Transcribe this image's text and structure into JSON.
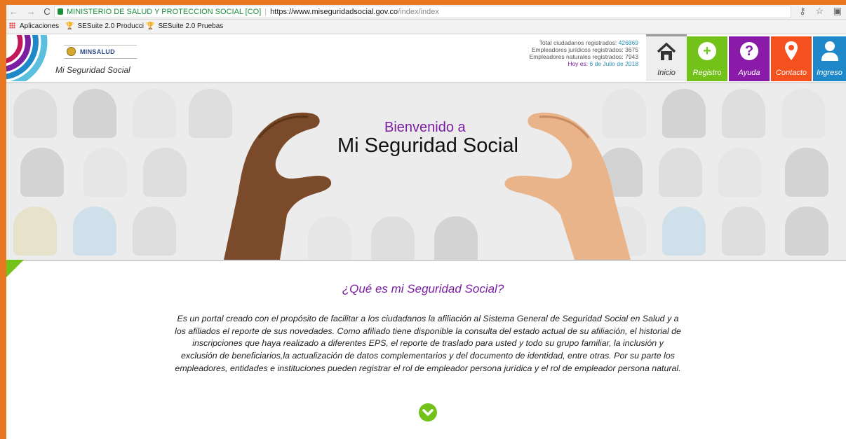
{
  "browser": {
    "site_name": "MINISTERIO DE SALUD Y PROTECCION SOCIAL [CO]",
    "url_host": "https://www.miseguridadsocial.gov.co",
    "url_path": "/index/index",
    "nav": {
      "back": "←",
      "forward": "→",
      "reload": "C"
    },
    "right_icons": {
      "key": "⚷",
      "star": "☆",
      "ext": "▣"
    }
  },
  "bookmarks": [
    {
      "label": "Aplicaciones"
    },
    {
      "label": "SESuite 2.0 Producci"
    },
    {
      "label": "SESuite 2.0 Pruebas"
    }
  ],
  "header": {
    "ministry": "MINSALUD",
    "app_name": "Mi Seguridad Social",
    "stats": {
      "citizens_label": "Total ciudadanos registrados:",
      "citizens_value": "426869",
      "juridicos": "Empleadores jurídicos registrados: 3675",
      "naturales": "Empleadores naturales registrados: 7943",
      "today_label": "Hoy es:",
      "today_value": "6 de Julio de 2018"
    },
    "nav": [
      {
        "label": "Inicio",
        "icon": "home-icon"
      },
      {
        "label": "Registro",
        "icon": "plus-icon",
        "glyph": "+"
      },
      {
        "label": "Ayuda",
        "icon": "question-icon",
        "glyph": "?"
      },
      {
        "label": "Contacto",
        "icon": "location-pin-icon"
      },
      {
        "label": "Ingreso",
        "icon": "user-icon"
      }
    ]
  },
  "hero": {
    "line1": "Bienvenido a",
    "line2": "Mi Seguridad Social"
  },
  "content": {
    "title": "¿Qué es mi Seguridad Social?",
    "description": "Es un portal creado con el propósito de facilitar a los ciudadanos la afiliación al Sistema General de Seguridad Social en Salud y a los afiliados el reporte de sus novedades. Como afiliado tiene disponible la consulta del estado actual de su afiliación, el historial de inscripciones que haya realizado a diferentes EPS, el reporte de traslado para usted y todo su grupo familiar, la inclusión y exclusión de beneficiarios,la actualización de datos complementarios y del documento de identidad, entre otras. Por su parte los empleadores, entidades e instituciones pueden registrar el rol de empleador persona jurídica y el rol de empleador persona natural."
  },
  "colors": {
    "frame": "#e87722",
    "purple": "#7b1fa2",
    "green": "#72c21a",
    "orange": "#f5511e",
    "blue": "#1e88c9"
  }
}
